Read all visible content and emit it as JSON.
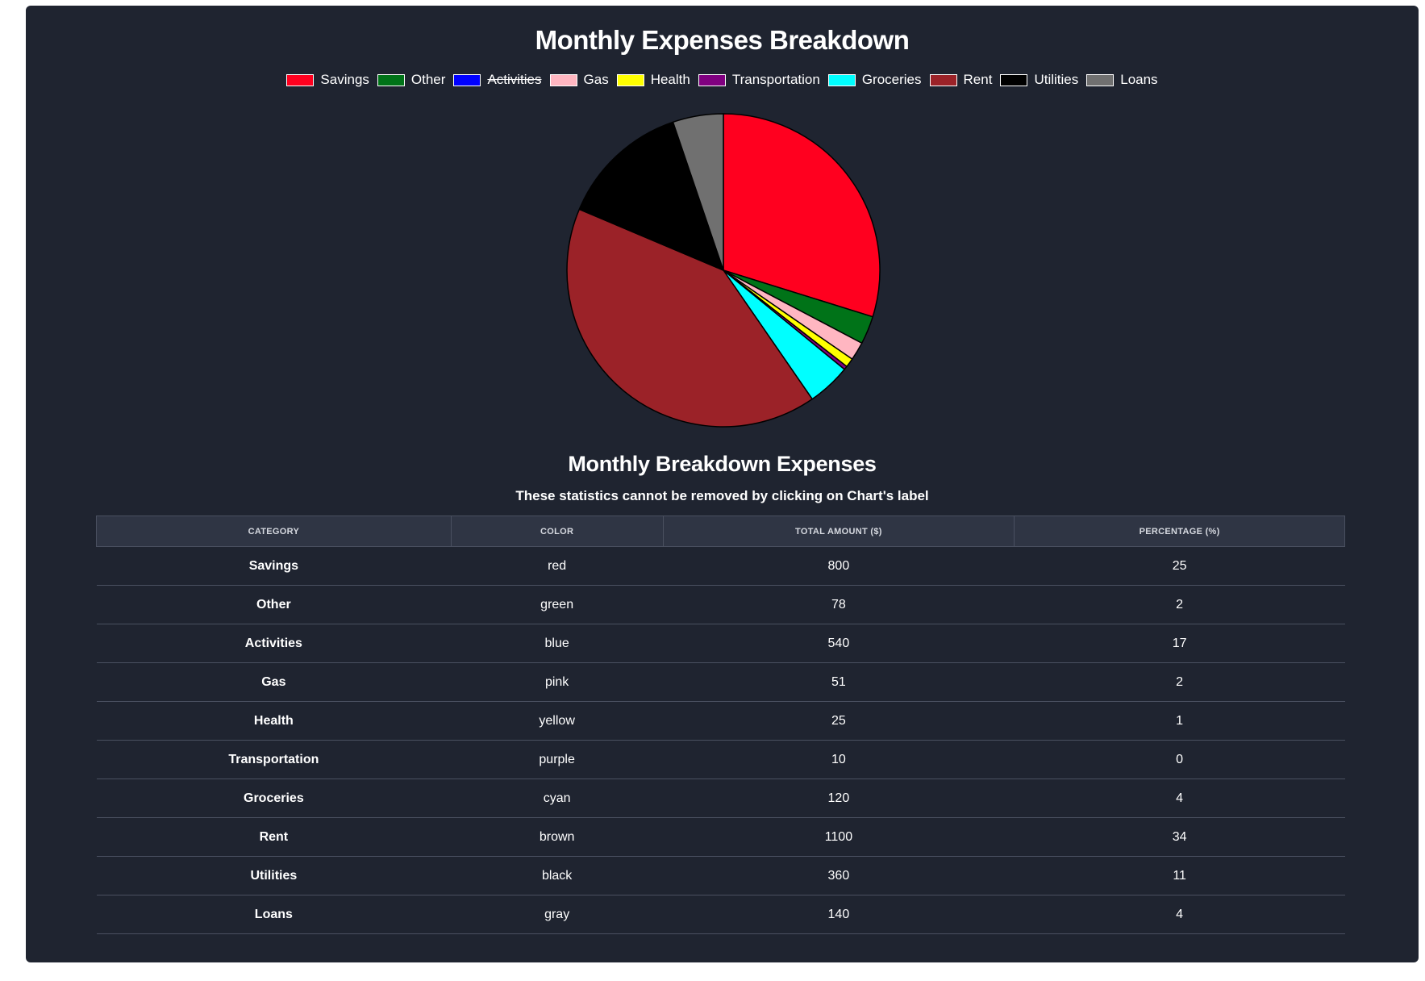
{
  "chart_data": {
    "type": "pie",
    "title": "Monthly Expenses Breakdown",
    "legend_position": "top",
    "categories": [
      "Savings",
      "Other",
      "Activities",
      "Gas",
      "Health",
      "Transportation",
      "Groceries",
      "Rent",
      "Utilities",
      "Loans"
    ],
    "colors": [
      "#ff001f",
      "#007318",
      "#0000ff",
      "#ffb6c1",
      "#ffff00",
      "#800080",
      "#00ffff",
      "#9b2228",
      "#000000",
      "#707070"
    ],
    "values": [
      800,
      78,
      540,
      51,
      25,
      10,
      120,
      1100,
      360,
      140
    ],
    "hidden": [
      false,
      false,
      true,
      false,
      false,
      false,
      false,
      false,
      false,
      false
    ]
  },
  "table": {
    "title": "Monthly Breakdown Expenses",
    "subtitle": "These statistics cannot be removed by clicking on Chart's label",
    "headers": [
      "CATEGORY",
      "COLOR",
      "TOTAL AMOUNT ($)",
      "PERCENTAGE (%)"
    ],
    "rows": [
      [
        "Savings",
        "red",
        "800",
        "25"
      ],
      [
        "Other",
        "green",
        "78",
        "2"
      ],
      [
        "Activities",
        "blue",
        "540",
        "17"
      ],
      [
        "Gas",
        "pink",
        "51",
        "2"
      ],
      [
        "Health",
        "yellow",
        "25",
        "1"
      ],
      [
        "Transportation",
        "purple",
        "10",
        "0"
      ],
      [
        "Groceries",
        "cyan",
        "120",
        "4"
      ],
      [
        "Rent",
        "brown",
        "1100",
        "34"
      ],
      [
        "Utilities",
        "black",
        "360",
        "11"
      ],
      [
        "Loans",
        "gray",
        "140",
        "4"
      ]
    ]
  }
}
